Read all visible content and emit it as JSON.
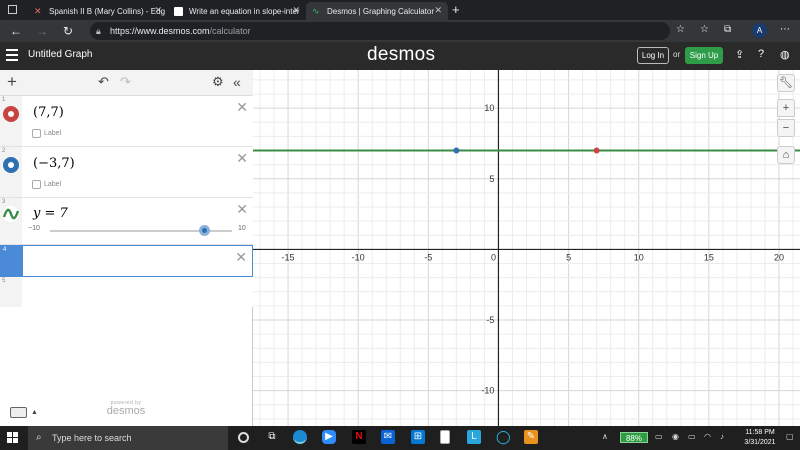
{
  "browser": {
    "tabs": [
      {
        "label": "Spanish II B (Mary Collins) - Edg",
        "active": false
      },
      {
        "label": "Write an equation in slope-inter",
        "active": false
      },
      {
        "label": "Desmos | Graphing Calculator",
        "active": true
      }
    ],
    "new_tab": "+",
    "url_host": "https://www.desmos.com",
    "url_path": "/calculator",
    "profile_initial": "A"
  },
  "desmos_header": {
    "graph_title": "Untitled Graph",
    "brand": "desmos",
    "login_label": "Log In",
    "or_text": "or",
    "signup_label": "Sign Up"
  },
  "expressions": [
    {
      "index": "1",
      "latex": "(7,7)",
      "color": "#c74440",
      "show_label": "Label",
      "kind": "point"
    },
    {
      "index": "2",
      "latex": "(−3,7)",
      "color": "#2d70b3",
      "show_label": "Label",
      "kind": "point"
    },
    {
      "index": "3",
      "latex": "y = 7",
      "color": "#388c46",
      "kind": "line",
      "slider": {
        "min_label": "−10",
        "max_label": "10",
        "value": 7,
        "min": -10,
        "max": 10
      }
    },
    {
      "index": "4",
      "latex": "",
      "kind": "empty"
    },
    {
      "index": "5",
      "latex": "",
      "kind": "empty"
    }
  ],
  "powered_by": {
    "line1": "powered by",
    "line2": "desmos"
  },
  "graph": {
    "x_ticks": [
      "-15",
      "-10",
      "-5",
      "0",
      "5",
      "10",
      "15",
      "20"
    ],
    "y_ticks": [
      "10",
      "5",
      "-5",
      "-10"
    ],
    "xlim": [
      -17.5,
      21.5
    ],
    "ylim": [
      -12.5,
      12.7
    ],
    "points": [
      {
        "x": 7,
        "y": 7,
        "color": "#c74440"
      },
      {
        "x": -3,
        "y": 7,
        "color": "#2d70b3"
      }
    ],
    "line_y": 7,
    "line_color": "#388c46",
    "tools": {
      "wrench": "wrench-icon",
      "zoom_in": "+",
      "zoom_out": "−",
      "home": "home-icon"
    }
  },
  "taskbar": {
    "search_placeholder": "Type here to search",
    "battery": "88%",
    "time": "11:58 PM",
    "date": "3/31/2021"
  }
}
